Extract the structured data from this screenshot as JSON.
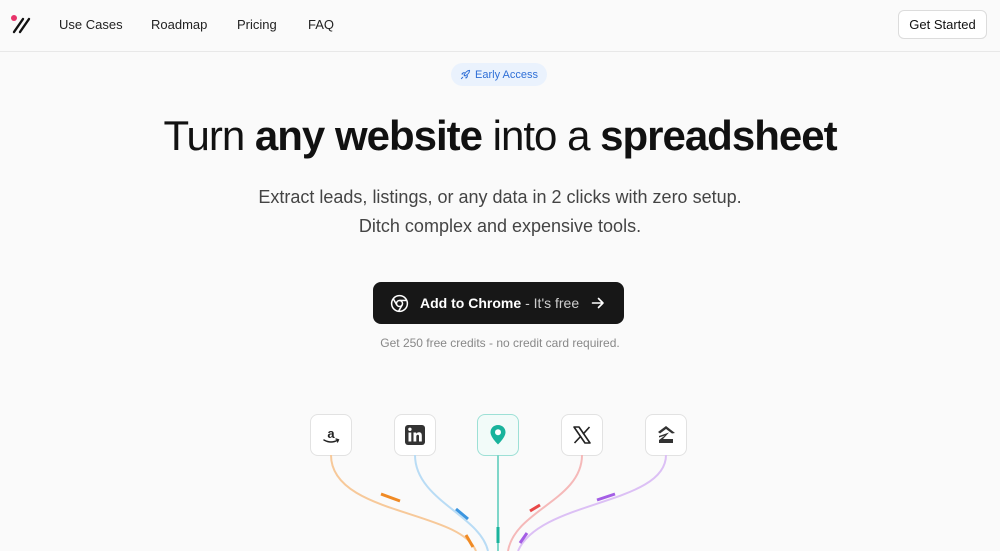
{
  "header": {
    "logo_icon": "slash-percent-logo-icon",
    "nav": [
      "Use Cases",
      "Roadmap",
      "Pricing",
      "FAQ"
    ],
    "cta_label": "Get Started"
  },
  "hero": {
    "badge": {
      "icon": "rocket-icon",
      "label": "Early Access",
      "color": "#2f6fd6"
    },
    "headline": {
      "part1": "Turn ",
      "bold1": "any website",
      "part2": " into a ",
      "bold2": "spreadsheet"
    },
    "subtitle_line1": "Extract leads, listings, or any data in 2 clicks with zero setup.",
    "subtitle_line2": "Ditch complex and expensive tools.",
    "cta": {
      "icon": "chrome-icon",
      "label": "Add to Chrome",
      "suffix": "- It's free",
      "arrow_icon": "arrow-right-icon"
    },
    "note": "Get 250 free credits - no credit card required."
  },
  "sources": [
    {
      "name": "amazon",
      "icon": "amazon-icon",
      "line_color": "#f7c99a",
      "accent": "#f08a24"
    },
    {
      "name": "linkedin",
      "icon": "linkedin-icon",
      "line_color": "#b9dcf5",
      "accent": "#3b95df"
    },
    {
      "name": "google-maps",
      "icon": "map-pin-icon",
      "line_color": "#7fd6c9",
      "accent": "#19b39c"
    },
    {
      "name": "x",
      "icon": "x-icon",
      "line_color": "#f5b9b9",
      "accent": "#e84848"
    },
    {
      "name": "zillow",
      "icon": "zillow-icon",
      "line_color": "#dcc0f5",
      "accent": "#a45ee5"
    }
  ]
}
